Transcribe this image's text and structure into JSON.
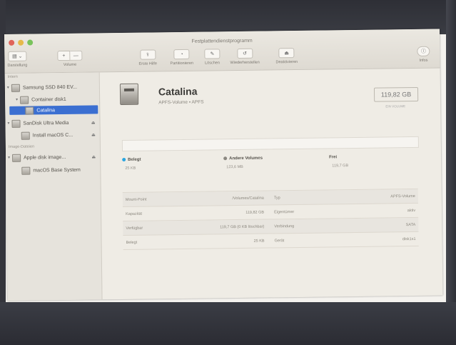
{
  "window": {
    "title": "Festplattendienstprogramm"
  },
  "toolbar": {
    "view_label": "Darstellung",
    "volume_label": "Volume",
    "first_aid_label": "Erste Hilfe",
    "partition_label": "Partitionieren",
    "erase_label": "Löschen",
    "restore_label": "Wiederherstellen",
    "unmount_label": "Deaktivieren",
    "info_label": "Infos",
    "add_glyph": "+",
    "remove_glyph": "—",
    "icons": [
      "sidebar-view-icon",
      "stethoscope-icon",
      "pie-partition-icon",
      "eraser-icon",
      "restore-arrow-icon",
      "unmount-icon",
      "info-icon"
    ]
  },
  "sidebar": {
    "internal_header": "Intern",
    "image_header": "Image-Dateien",
    "items": [
      {
        "label": "Samsung SSD 840 EV..."
      },
      {
        "label": "Container disk1"
      },
      {
        "label": "Catalina"
      },
      {
        "label": "SanDisk Ultra Media"
      },
      {
        "label": "Install macOS C..."
      },
      {
        "label": "Apple disk image..."
      },
      {
        "label": "macOS Base System"
      }
    ]
  },
  "volume": {
    "name": "Catalina",
    "subtitle": "APFS-Volume • APFS",
    "capacity": "119,82 GB",
    "capacity_caption": "EIN VOLUME"
  },
  "usage": {
    "used_label": "Belegt",
    "used_value": "25 KB",
    "used_color": "#2aa5e0",
    "other_label": "Andere Volumes",
    "other_value": "123,6 MB",
    "other_color": "#8a8780",
    "free_label": "Frei",
    "free_value": "119,7 GB"
  },
  "info": {
    "rows": [
      {
        "k1": "Mount-Point",
        "v1": "/Volumes/Catalina",
        "k2": "Typ",
        "v2": "APFS-Volume"
      },
      {
        "k1": "Kapazität",
        "v1": "119,82 GB",
        "k2": "Eigentümer",
        "v2": "aktiv"
      },
      {
        "k1": "Verfügbar",
        "v1": "119,7 GB (0 KB löschbar)",
        "k2": "Verbindung",
        "v2": "SATA"
      },
      {
        "k1": "Belegt",
        "v1": "25 KB",
        "k2": "Gerät",
        "v2": "disk1s1"
      }
    ]
  }
}
